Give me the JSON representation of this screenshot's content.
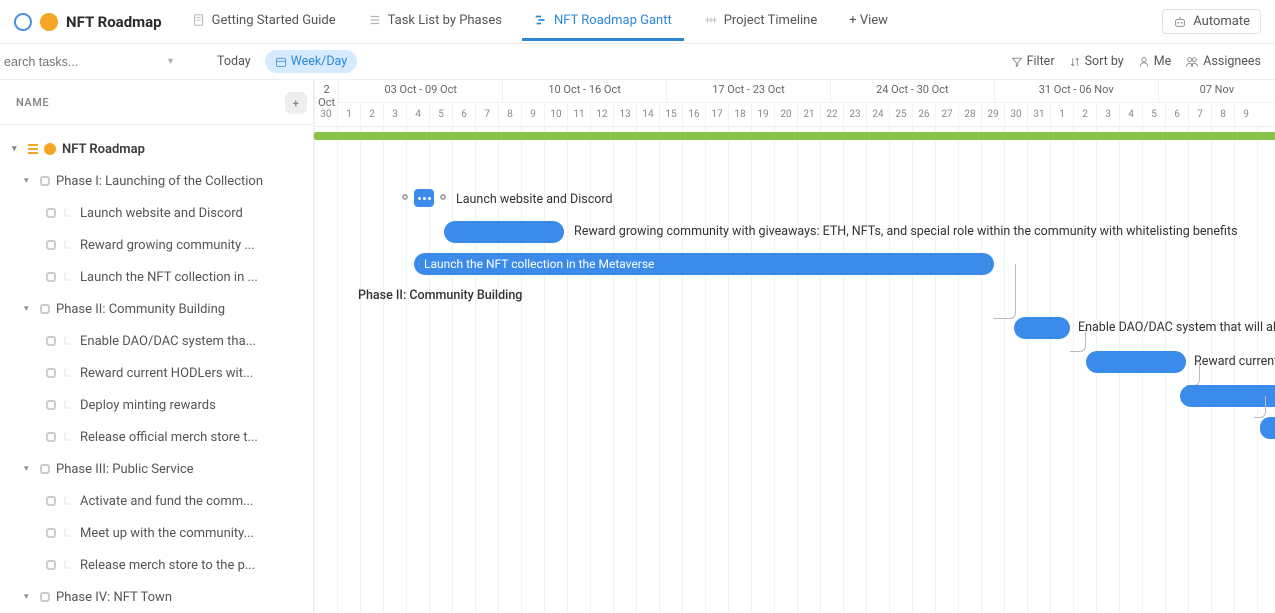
{
  "header": {
    "project_title": "NFT Roadmap",
    "tabs": [
      {
        "label": "Getting Started Guide"
      },
      {
        "label": "Task List by Phases"
      },
      {
        "label": "NFT Roadmap Gantt"
      },
      {
        "label": "Project Timeline"
      },
      {
        "label": "+ View"
      }
    ],
    "automate_label": "Automate"
  },
  "toolbar": {
    "search_placeholder": "earch tasks...",
    "today_label": "Today",
    "period_label": "Week/Day",
    "filter_label": "Filter",
    "sort_label": "Sort by",
    "me_label": "Me",
    "assignees_label": "Assignees"
  },
  "sidebar": {
    "column_header": "NAME",
    "root": "NFT Roadmap",
    "phases": [
      {
        "title": "Phase I: Launching of the Collection",
        "tasks": [
          "Launch website and Discord",
          "Reward growing community ...",
          "Launch the NFT collection in ..."
        ]
      },
      {
        "title": "Phase II: Community Building",
        "tasks": [
          "Enable DAO/DAC system tha...",
          "Reward current HODLers wit...",
          "Deploy minting rewards",
          "Release official merch store t..."
        ]
      },
      {
        "title": "Phase III: Public Service",
        "tasks": [
          "Activate and fund the comm...",
          "Meet up with the community...",
          "Release merch store to the p..."
        ]
      },
      {
        "title": "Phase IV: NFT Town",
        "tasks": []
      }
    ]
  },
  "timeline": {
    "weeks": [
      "2 Oct",
      "03 Oct - 09 Oct",
      "10 Oct - 16 Oct",
      "17 Oct - 23 Oct",
      "24 Oct - 30 Oct",
      "31 Oct - 06 Nov",
      "07 Nov"
    ],
    "days": [
      "30",
      "1",
      "2",
      "3",
      "4",
      "5",
      "6",
      "7",
      "8",
      "9",
      "10",
      "11",
      "12",
      "13",
      "14",
      "15",
      "16",
      "17",
      "18",
      "19",
      "20",
      "21",
      "22",
      "23",
      "24",
      "25",
      "26",
      "27",
      "28",
      "29",
      "30",
      "31",
      "1",
      "2",
      "3",
      "4",
      "5",
      "6",
      "7",
      "8",
      "9"
    ],
    "bars": {
      "task1_label": "Launch website and Discord",
      "task2_label": "Reward growing community with giveaways: ETH, NFTs, and special role within the community with whitelisting benefits",
      "task3_label": "Launch the NFT collection in the Metaverse",
      "phase2_label": "Phase II: Community Building",
      "task4_label": "Enable DAO/DAC system that will allow",
      "task5_label": "Reward current "
    }
  },
  "chart_data": {
    "type": "gantt",
    "title": "NFT Roadmap Gantt",
    "x_range": [
      "2022-09-30",
      "2022-11-09"
    ],
    "tasks": [
      {
        "name": "Launch website and Discord",
        "phase": "Phase I",
        "start": "2022-10-04",
        "end": "2022-10-04",
        "milestone": true
      },
      {
        "name": "Reward growing community with giveaways: ETH, NFTs, and special role within the community with whitelisting benefits",
        "phase": "Phase I",
        "start": "2022-10-05",
        "end": "2022-10-09"
      },
      {
        "name": "Launch the NFT collection in the Metaverse",
        "phase": "Phase I",
        "start": "2022-10-04",
        "end": "2022-10-29"
      },
      {
        "name": "Enable DAO/DAC system that will allow...",
        "phase": "Phase II",
        "start": "2022-10-30",
        "end": "2022-11-01"
      },
      {
        "name": "Reward current HODLers wit...",
        "phase": "Phase II",
        "start": "2022-11-02",
        "end": "2022-11-06"
      },
      {
        "name": "Deploy minting rewards",
        "phase": "Phase II",
        "start": "2022-11-06",
        "end": "2022-11-10"
      },
      {
        "name": "Release official merch store t...",
        "phase": "Phase II",
        "start": "2022-11-09",
        "end": "2022-11-09",
        "milestone": true
      }
    ]
  }
}
